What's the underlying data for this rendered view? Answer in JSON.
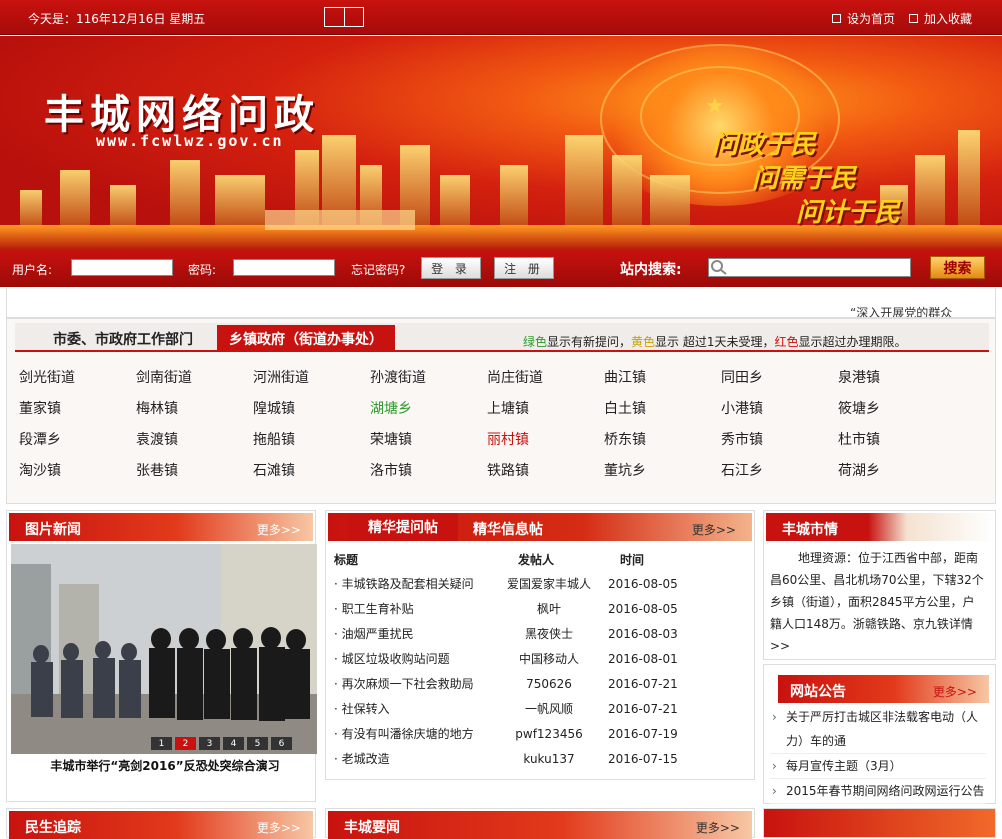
{
  "topbar": {
    "date": "今天是：116年12月16日 星期五",
    "set_home": "设为首页",
    "add_fav": "加入收藏"
  },
  "banner": {
    "title": "丰城网络问政",
    "url": "www.fcwlwz.gov.cn",
    "slogan1": "问政于民",
    "slogan2": "问需于民",
    "slogan3": "问计于民"
  },
  "login": {
    "username_label": "用户名:",
    "password_label": "密码:",
    "forgot": "忘记密码?",
    "login_btn": "登 录",
    "register_btn": "注 册",
    "search_label": "站内搜索:",
    "search_btn": "搜索"
  },
  "notice": {
    "text": "“深入开展党的群众"
  },
  "depts": {
    "tab1": "市委、市政府工作部门",
    "tab2": "乡镇政府（街道办事处）",
    "legend": {
      "green": "绿色",
      "t1": "显示有新提问，",
      "yellow": "黄色",
      "t2": "显示 超过1天未受理，",
      "red": "红色",
      "t3": "显示超过办理期限。"
    },
    "items": [
      [
        "剑光街道",
        "剑南街道",
        "河洲街道",
        "孙渡街道",
        "尚庄街道",
        "曲江镇",
        "同田乡",
        "泉港镇"
      ],
      [
        "董家镇",
        "梅林镇",
        "隍城镇",
        "湖塘乡",
        "上塘镇",
        "白土镇",
        "小港镇",
        "筱塘乡"
      ],
      [
        "段潭乡",
        "袁渡镇",
        "拖船镇",
        "荣塘镇",
        "丽村镇",
        "桥东镇",
        "秀市镇",
        "杜市镇"
      ],
      [
        "淘沙镇",
        "张巷镇",
        "石滩镇",
        "洛市镇",
        "铁路镇",
        "董坑乡",
        "石江乡",
        "荷湖乡"
      ]
    ],
    "colors": {
      "green": "#2a9a2a",
      "yellow": "#c8a000",
      "red": "#c8120f"
    }
  },
  "photo_news": {
    "title": "图片新闻",
    "more": "更多>>",
    "caption": "丰城市举行“亮剑2016”反恐处突综合演习",
    "pages": [
      "1",
      "2",
      "3",
      "4",
      "5",
      "6"
    ]
  },
  "posts": {
    "tab1": "精华提问帖",
    "tab2": "精华信息帖",
    "more": "更多>>",
    "headers": [
      "标题",
      "发帖人",
      "时间"
    ],
    "rows": [
      [
        "丰城铁路及配套相关疑问",
        "爱国爱家丰城人",
        "2016-08-05"
      ],
      [
        "职工生育补贴",
        "枫叶",
        "2016-08-05"
      ],
      [
        "油烟严重扰民",
        "黑夜侠士",
        "2016-08-03"
      ],
      [
        "城区垃圾收购站问题",
        "中国移动人",
        "2016-08-01"
      ],
      [
        "再次麻烦一下社会救助局",
        "750626",
        "2016-07-21"
      ],
      [
        "社保转入",
        "一帆风顺",
        "2016-07-21"
      ],
      [
        "有没有叫潘徐庆塘的地方",
        "pwf123456",
        "2016-07-19"
      ],
      [
        "老城改造",
        "kuku137",
        "2016-07-15"
      ]
    ]
  },
  "city": {
    "title": "丰城市情",
    "text": "地理资源：位于江西省中部，距南昌60公里、昌北机场70公里，下辖32个乡镇（街道），面积2845平方公里，户籍人口148万。浙赣铁路、京九铁",
    "more": "详情>>"
  },
  "announce": {
    "title": "网站公告",
    "more": "更多>>",
    "items": [
      "关于严厉打击城区非法载客电动（人力）车的通",
      "每月宣传主题（3月）",
      "2015年春节期间网络问政网运行公告"
    ]
  },
  "bottom": {
    "left_title": "民生追踪",
    "left_more": "更多>>",
    "mid_title": "丰城要闻",
    "mid_more": "更多>>"
  }
}
